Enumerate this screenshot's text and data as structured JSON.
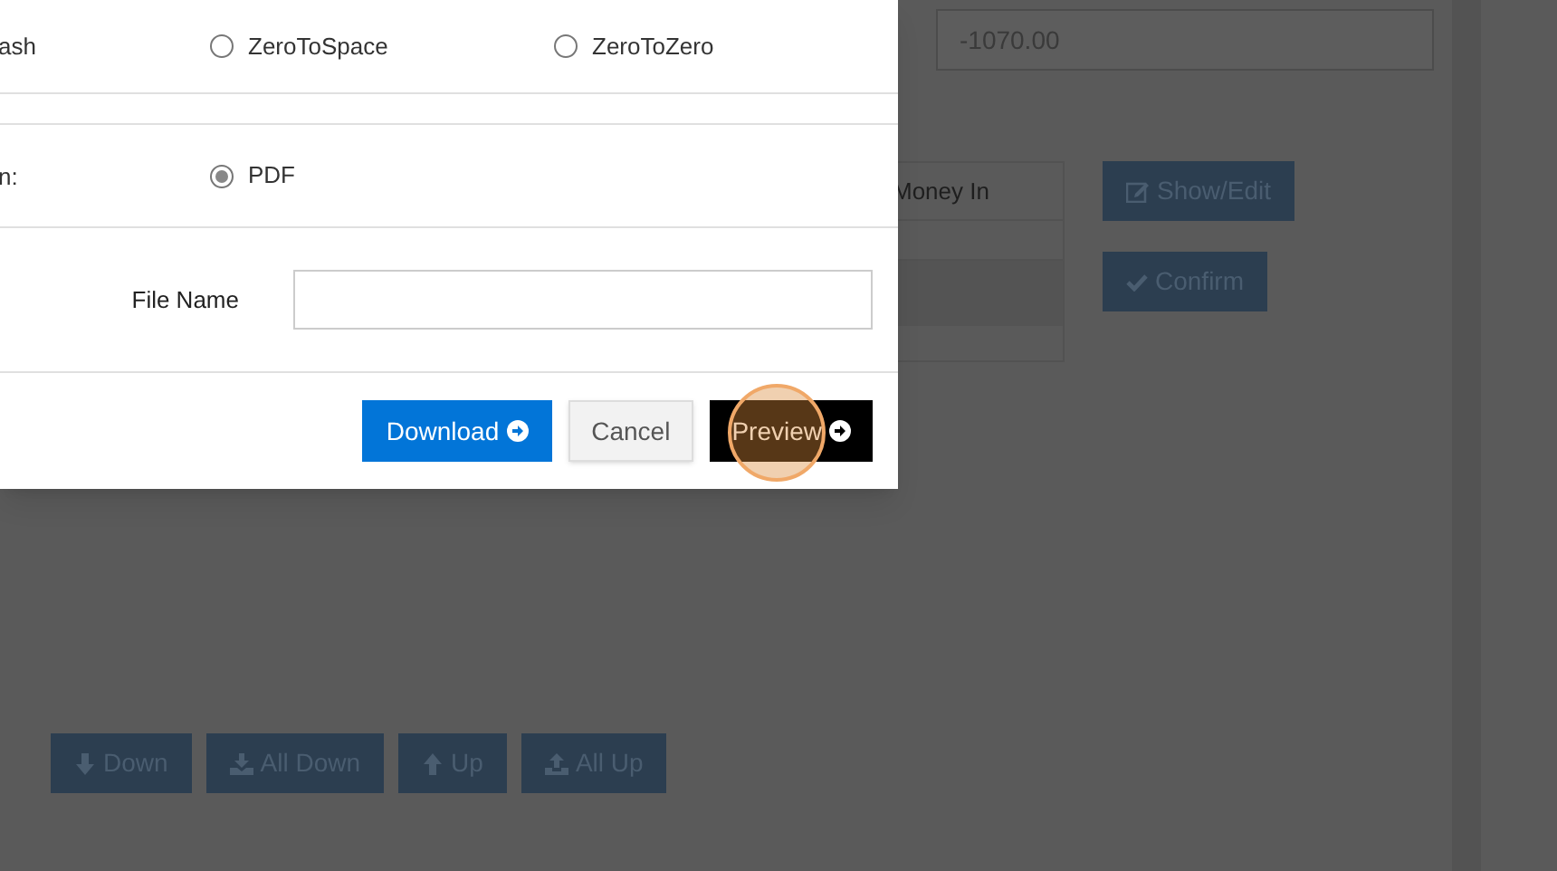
{
  "background": {
    "amount": "-1070.00",
    "table_header": "Money In",
    "action_buttons": [
      {
        "label": "Show/Edit",
        "kind": "edit"
      },
      {
        "label": "Confirm",
        "kind": "check"
      }
    ],
    "move_buttons": [
      {
        "label": "Down",
        "kind": "down"
      },
      {
        "label": "All Down",
        "kind": "all-down"
      },
      {
        "label": "Up",
        "kind": "up"
      },
      {
        "label": "All Up",
        "kind": "all-up"
      }
    ]
  },
  "dialog": {
    "row_1_label": "ash",
    "zero_options": [
      {
        "label": "ZeroToSpace",
        "selected": false
      },
      {
        "label": "ZeroToZero",
        "selected": false
      }
    ],
    "row_2_label": "n:",
    "output_options": [
      {
        "label": "PDF",
        "selected": true
      }
    ],
    "file_name_label": "File Name",
    "buttons": [
      {
        "label": "Download",
        "kind": "primary"
      },
      {
        "label": "Cancel",
        "kind": "default"
      },
      {
        "label": "Preview",
        "kind": "dark"
      }
    ]
  }
}
